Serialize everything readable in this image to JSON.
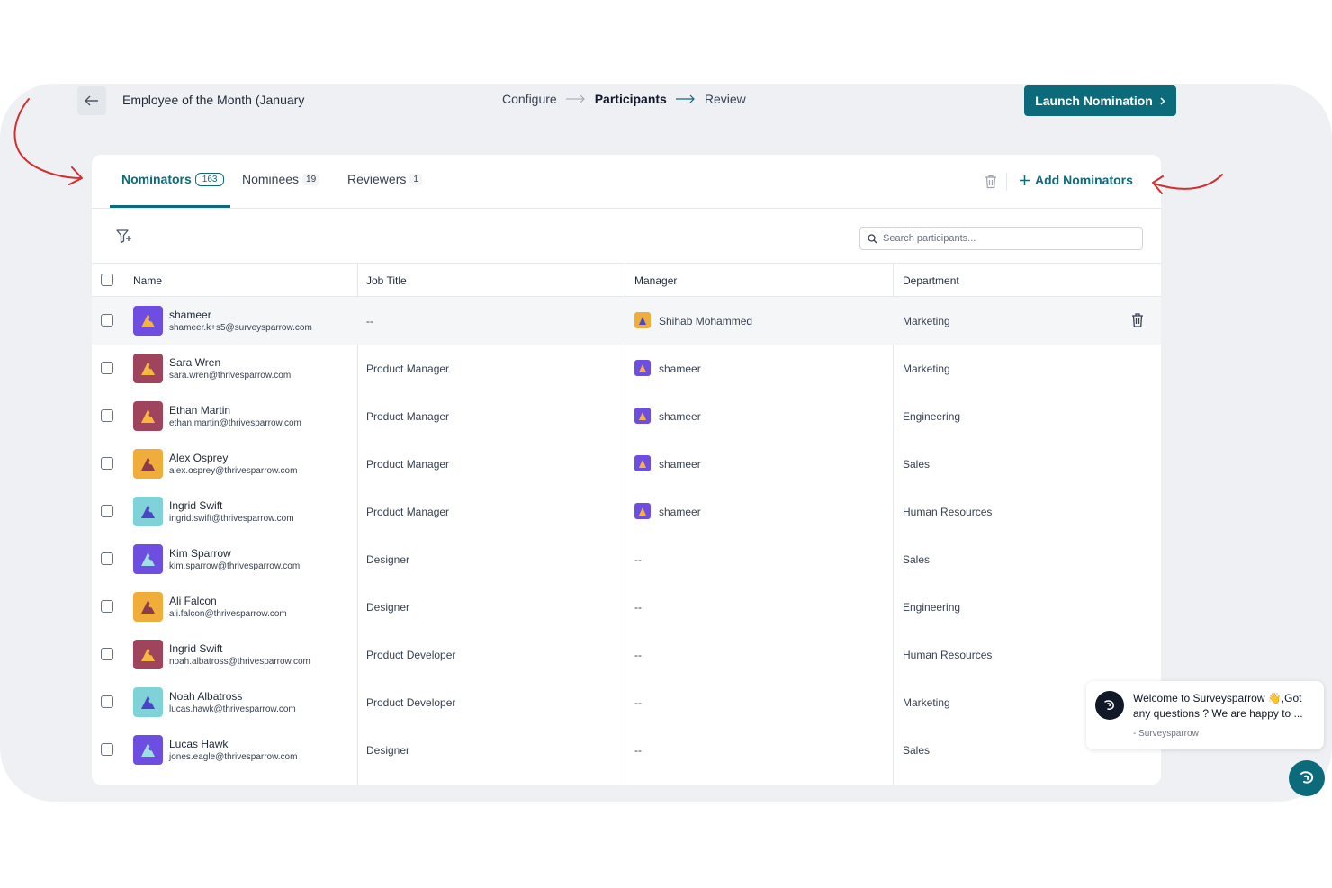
{
  "header": {
    "title": "Employee of the Month (January",
    "steps": [
      {
        "label": "Configure",
        "active": false
      },
      {
        "label": "Participants",
        "active": true
      },
      {
        "label": "Review",
        "active": false
      }
    ],
    "launch_label": "Launch Nomination"
  },
  "tabs": [
    {
      "label": "Nominators",
      "count": "163",
      "active": true
    },
    {
      "label": "Nominees",
      "count": "19",
      "active": false
    },
    {
      "label": "Reviewers",
      "count": "1",
      "active": false
    }
  ],
  "add_label": "Add Nominators",
  "search": {
    "placeholder": "Search participants..."
  },
  "columns": [
    "Name",
    "Job Title",
    "Manager",
    "Department"
  ],
  "rows": [
    {
      "name": "shameer",
      "email": "shameer.k+s5@surveysparrow.com",
      "job": "--",
      "manager": "Shihab Mohammed",
      "department": "Marketing",
      "avatar_bg": "#6d4ee0",
      "avatar_fg": "#f6b43c",
      "mgr_bg": "#f0ad3a",
      "mgr_fg": "#4a4bc8",
      "hover": true
    },
    {
      "name": "Sara Wren",
      "email": "sara.wren@thrivesparrow.com",
      "job": "Product Manager",
      "manager": "shameer",
      "department": "Marketing",
      "avatar_bg": "#a0435c",
      "avatar_fg": "#f5b940",
      "mgr_bg": "#6d4ee0",
      "mgr_fg": "#f6b43c"
    },
    {
      "name": "Ethan Martin",
      "email": "ethan.martin@thrivesparrow.com",
      "job": "Product Manager",
      "manager": "shameer",
      "department": "Engineering",
      "avatar_bg": "#a0435c",
      "avatar_fg": "#f5b940",
      "mgr_bg": "#6d4ee0",
      "mgr_fg": "#f6b43c"
    },
    {
      "name": "Alex Osprey",
      "email": "alex.osprey@thrivesparrow.com",
      "job": "Product Manager",
      "manager": "shameer",
      "department": "Sales",
      "avatar_bg": "#f0ad3a",
      "avatar_fg": "#8e3a4e",
      "mgr_bg": "#6d4ee0",
      "mgr_fg": "#f6b43c"
    },
    {
      "name": "Ingrid Swift",
      "email": "ingrid.swift@thrivesparrow.com",
      "job": "Product Manager",
      "manager": "shameer",
      "department": "Human Resources",
      "avatar_bg": "#7fd3d8",
      "avatar_fg": "#4b43c8",
      "mgr_bg": "#6d4ee0",
      "mgr_fg": "#f6b43c"
    },
    {
      "name": "Kim Sparrow",
      "email": "kim.sparrow@thrivesparrow.com",
      "job": "Designer",
      "manager": "--",
      "department": "Sales",
      "avatar_bg": "#6d4ee0",
      "avatar_fg": "#9ee0e4",
      "mgr_bg": "",
      "mgr_fg": ""
    },
    {
      "name": "Ali Falcon",
      "email": "ali.falcon@thrivesparrow.com",
      "job": "Designer",
      "manager": "--",
      "department": "Engineering",
      "avatar_bg": "#f0ad3a",
      "avatar_fg": "#8e3a4e",
      "mgr_bg": "",
      "mgr_fg": ""
    },
    {
      "name": "Ingrid Swift",
      "email": "noah.albatross@thrivesparrow.com",
      "job": "Product Developer",
      "manager": "--",
      "department": "Human Resources",
      "avatar_bg": "#a0435c",
      "avatar_fg": "#f5b940",
      "mgr_bg": "",
      "mgr_fg": ""
    },
    {
      "name": "Noah Albatross",
      "email": "lucas.hawk@thrivesparrow.com",
      "job": "Product Developer",
      "manager": "--",
      "department": "Marketing",
      "avatar_bg": "#7fd3d8",
      "avatar_fg": "#4b43c8",
      "mgr_bg": "",
      "mgr_fg": ""
    },
    {
      "name": "Lucas Hawk",
      "email": "jones.eagle@thrivesparrow.com",
      "job": "Designer",
      "manager": "--",
      "department": "Sales",
      "avatar_bg": "#6d4ee0",
      "avatar_fg": "#9ee0e4",
      "mgr_bg": "",
      "mgr_fg": ""
    }
  ],
  "chat": {
    "message": "Welcome to Surveysparrow 👋,Got any questions ? We are happy to ...",
    "from": "- Surveysparrow"
  },
  "colors": {
    "accent": "#0b6b7a",
    "annotation": "#d32f2f"
  }
}
